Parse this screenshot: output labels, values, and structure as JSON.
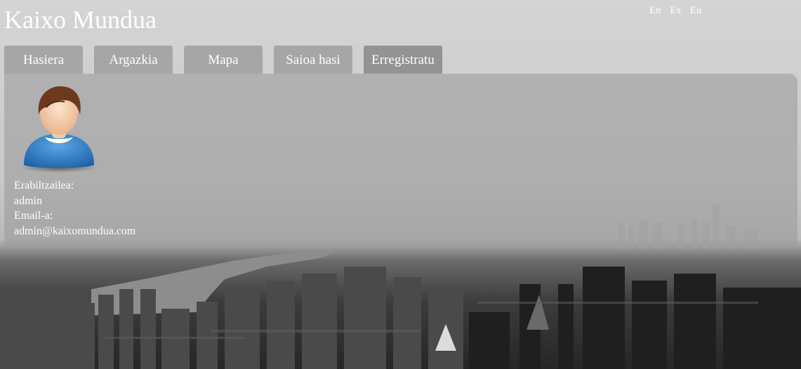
{
  "header": {
    "title": "Kaixo Mundua",
    "languages": [
      "En",
      "Es",
      "Eu"
    ]
  },
  "nav": {
    "tabs": [
      {
        "label": "Hasiera"
      },
      {
        "label": "Argazkia"
      },
      {
        "label": "Mapa"
      },
      {
        "label": "Saioa hasi"
      },
      {
        "label": "Erregistratu",
        "active": true
      }
    ]
  },
  "profile": {
    "avatar_icon": "user-avatar-icon",
    "username_label": "Erabiltzailea:",
    "username": "admin",
    "email_label": "Email-a:",
    "email": "admin@kaixomundua.com"
  },
  "colors": {
    "tab_bg": "#969696",
    "panel_bg": "#9b9b9b",
    "text": "#ffffff",
    "avatar_shirt": "#2f7fc8",
    "avatar_hair": "#6b3a1e"
  }
}
